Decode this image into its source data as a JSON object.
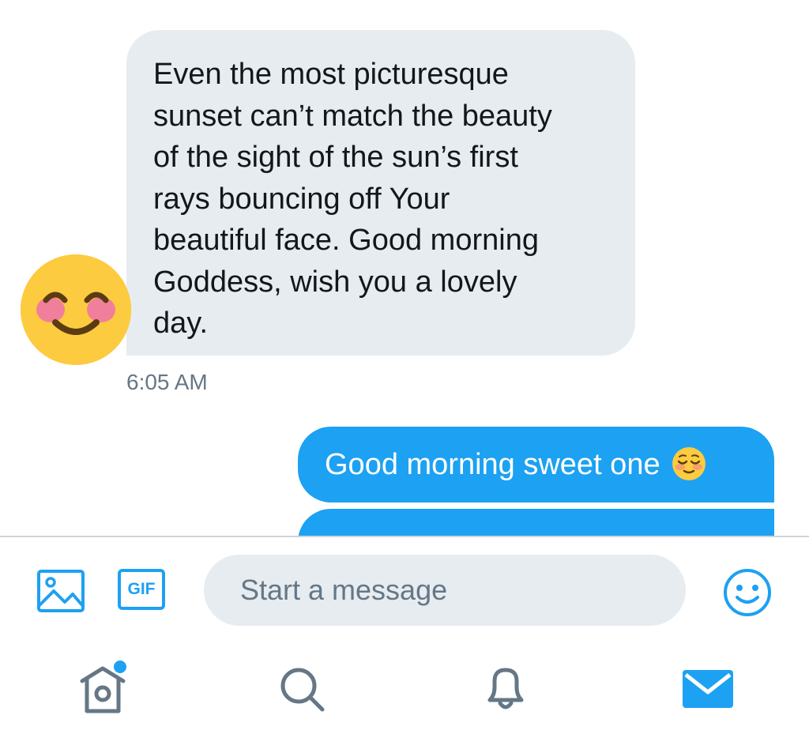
{
  "conversation": {
    "incoming_message": {
      "lines": [
        "Even the most picturesque",
        "sunset can’t match the beauty",
        "of the sight of the sun’s first",
        "rays bouncing off Your",
        "beautiful face. Good morning",
        "Goddess, wish you a lovely",
        "day."
      ],
      "timestamp": "6:05 AM",
      "avatar_icon": "smiling-blush-emoji"
    },
    "outgoing_message": {
      "text": "Good morning sweet one",
      "emoji_icon": "relieved-face-emoji"
    }
  },
  "composer": {
    "placeholder": "Start a message",
    "value": "",
    "media_icon": "image-icon",
    "gif_label": "GIF",
    "emoji_icon": "smiley-icon"
  },
  "tabbar": {
    "items": [
      {
        "name": "home",
        "icon": "home-icon",
        "has_badge": true
      },
      {
        "name": "search",
        "icon": "search-icon"
      },
      {
        "name": "notifications",
        "icon": "bell-icon"
      },
      {
        "name": "messages",
        "icon": "envelope-icon",
        "active": true
      }
    ]
  },
  "colors": {
    "accent": "#1da1f2",
    "incoming_bubble": "#e6ecf0",
    "icon_gray": "#657786",
    "text": "#14171a"
  }
}
